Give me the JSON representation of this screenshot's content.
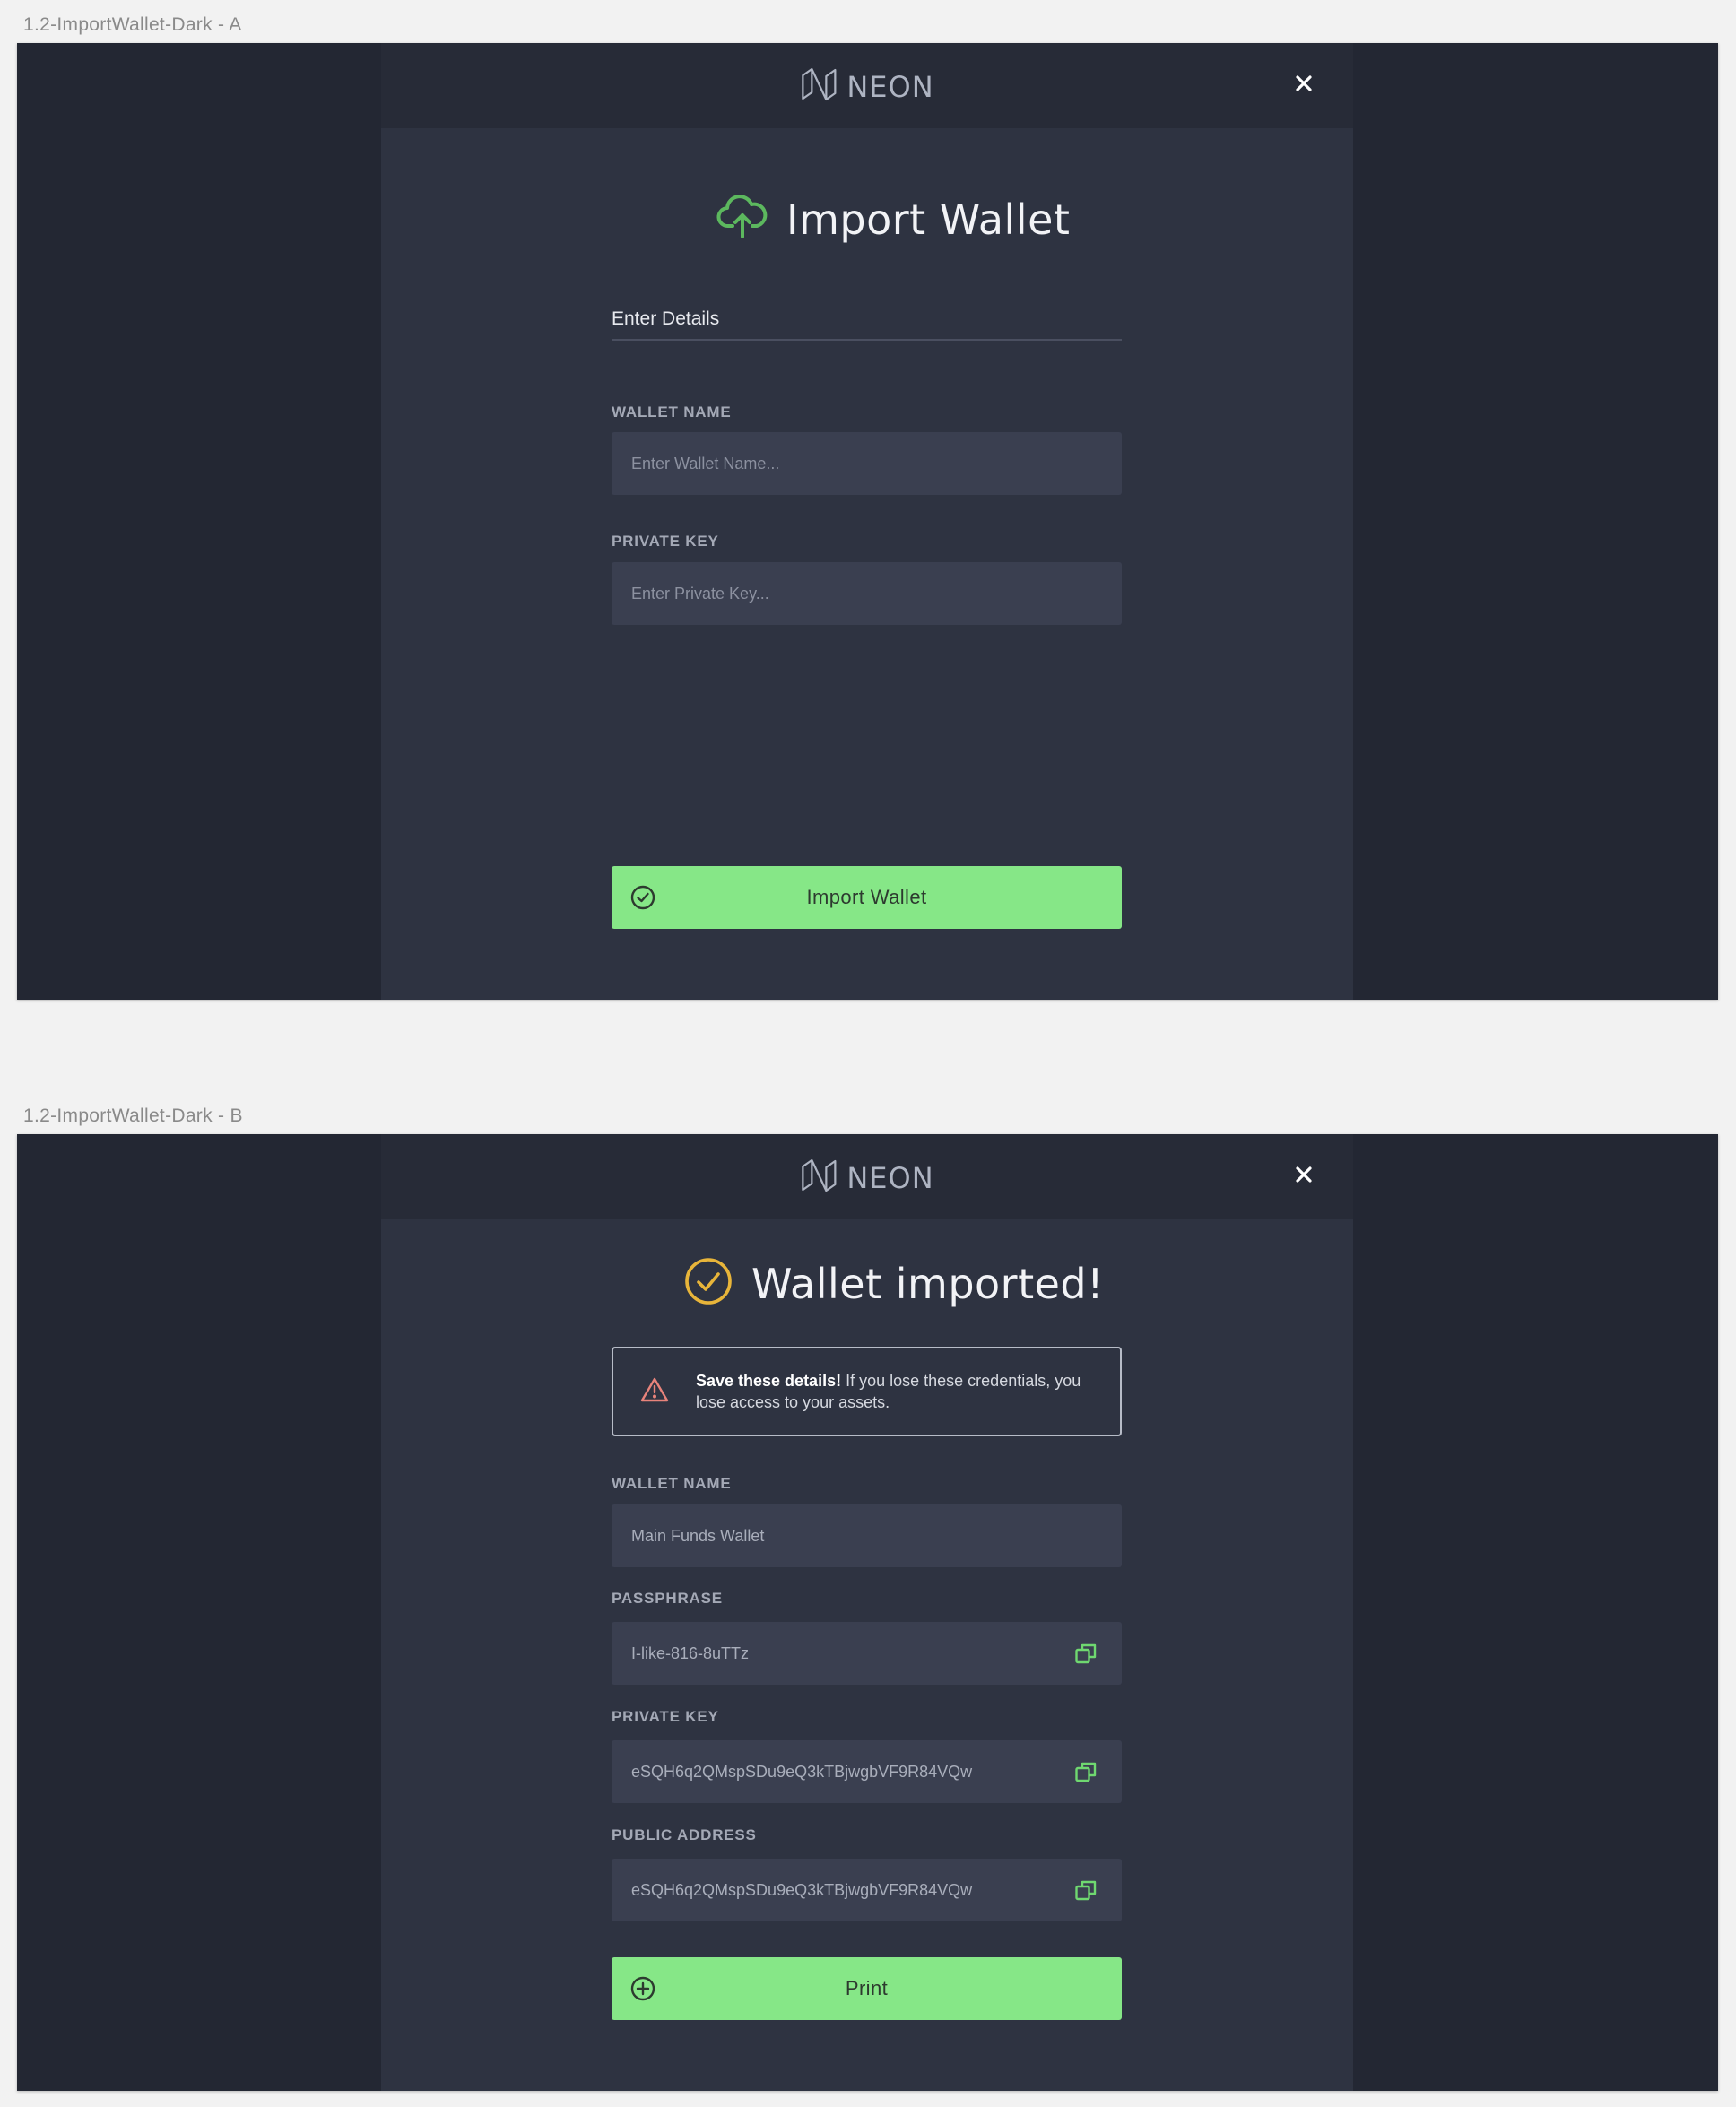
{
  "artboards": {
    "a": {
      "label": "1.2-ImportWallet-Dark - A"
    },
    "b": {
      "label": "1.2-ImportWallet-Dark - B"
    }
  },
  "brand": {
    "name": "NEON",
    "accent": "#86e787",
    "logo_icon": "neon-logo-icon"
  },
  "screen_a": {
    "title": "Import Wallet",
    "title_icon": "cloud-upload-icon",
    "step_tab": "Enter Details",
    "wallet_name": {
      "label": "WALLET NAME",
      "placeholder": "Enter Wallet Name..."
    },
    "private_key": {
      "label": "PRIVATE KEY",
      "placeholder": "Enter Private Key..."
    },
    "submit": {
      "label": "Import Wallet",
      "icon": "check-circle-icon"
    }
  },
  "screen_b": {
    "title": "Wallet imported!",
    "title_icon": "check-circle-icon",
    "title_icon_color": "#e8b53a",
    "warning": {
      "icon": "warning-triangle-icon",
      "icon_color": "#e8837b",
      "bold": "Save these details!",
      "text": " If you lose these credentials, you lose access to your assets."
    },
    "wallet_name": {
      "label": "WALLET NAME",
      "value": "Main Funds Wallet"
    },
    "passphrase": {
      "label": "PASSPHRASE",
      "value": "I-like-816-8uTTz"
    },
    "private_key": {
      "label": "PRIVATE KEY",
      "value": "eSQH6q2QMspSDu9eQ3kTBjwgbVF9R84VQw"
    },
    "public_address": {
      "label": "PUBLIC ADDRESS",
      "value": "eSQH6q2QMspSDu9eQ3kTBjwgbVF9R84VQw"
    },
    "print": {
      "label": "Print",
      "icon": "plus-circle-icon"
    }
  }
}
